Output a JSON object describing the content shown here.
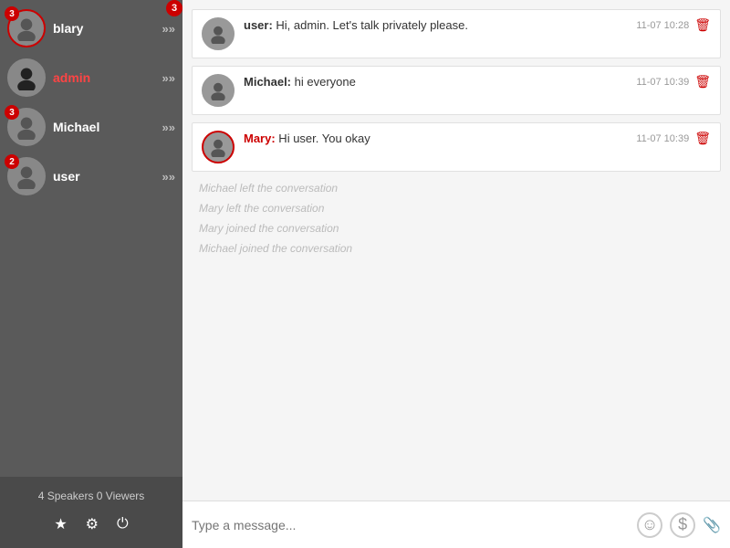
{
  "sidebar": {
    "top_badge": "3",
    "users": [
      {
        "name": "blary",
        "badge": "3",
        "red_border": true,
        "red_name": false,
        "has_avatar_img": false
      },
      {
        "name": "admin",
        "badge": null,
        "red_border": false,
        "red_name": true,
        "has_avatar_img": true
      },
      {
        "name": "Michael",
        "badge": "3",
        "red_border": false,
        "red_name": false,
        "has_avatar_img": false
      },
      {
        "name": "user",
        "badge": "2",
        "red_border": false,
        "red_name": false,
        "has_avatar_img": false
      }
    ],
    "stats": "4 Speakers  0 Viewers",
    "actions": [
      "star",
      "gear",
      "power"
    ]
  },
  "messages": [
    {
      "sender": "user",
      "sender_color": "normal",
      "text": "Hi, admin. Let's talk privately please.",
      "time": "11-07 10:28",
      "has_red_ring": false
    },
    {
      "sender": "Michael",
      "sender_color": "normal",
      "text": "hi everyone",
      "time": "11-07 10:39",
      "has_red_ring": false
    },
    {
      "sender": "Mary",
      "sender_color": "red",
      "text": "Hi user. You okay",
      "time": "11-07 10:39",
      "has_red_ring": true
    }
  ],
  "system_messages": [
    "Michael left the conversation",
    "Mary left the conversation",
    "Mary joined the conversation",
    "Michael joined the conversation"
  ],
  "input": {
    "placeholder": "Type a message..."
  }
}
